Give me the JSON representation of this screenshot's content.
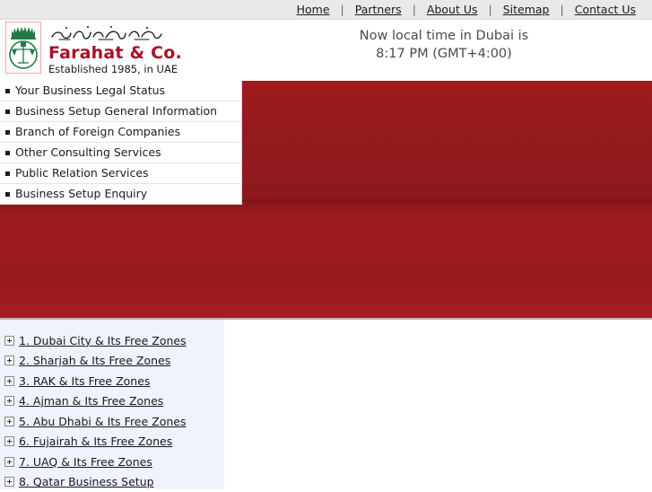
{
  "topnav": {
    "items": [
      {
        "label": "Home"
      },
      {
        "label": "Partners"
      },
      {
        "label": "About Us"
      },
      {
        "label": "Sitemap"
      },
      {
        "label": "Contact Us"
      }
    ],
    "separator": "|"
  },
  "header": {
    "brand_name": "Farahat & Co.",
    "brand_tagline": "Established 1985, in UAE",
    "emblem_icon": "scales-of-justice-palm-crown-icon",
    "arabic_script_icon": "arabic-calligraphy-logo",
    "clock_line1": "Now local time in Dubai is",
    "clock_line2": "8:17 PM (GMT+4:00)"
  },
  "menu": {
    "items": [
      {
        "label": "Your Business Legal Status"
      },
      {
        "label": "Business Setup General Information"
      },
      {
        "label": "Branch of Foreign Companies"
      },
      {
        "label": "Other Consulting Services"
      },
      {
        "label": "Public Relation Services"
      },
      {
        "label": "Business Setup Enquiry"
      }
    ]
  },
  "sidebar": {
    "items": [
      {
        "label": "1. Dubai City & Its Free Zones",
        "icon": "plus-expander-icon"
      },
      {
        "label": "2. Sharjah & Its Free Zones",
        "icon": "plus-expander-icon"
      },
      {
        "label": "3. RAK & Its Free Zones",
        "icon": "plus-expander-icon"
      },
      {
        "label": "4. Ajman & Its Free Zones",
        "icon": "plus-expander-icon"
      },
      {
        "label": "5. Abu Dhabi & Its Free Zones",
        "icon": "plus-expander-icon"
      },
      {
        "label": "6. Fujairah & Its Free Zones",
        "icon": "plus-expander-icon"
      },
      {
        "label": "7. UAQ & Its Free Zones",
        "icon": "plus-expander-icon"
      },
      {
        "label": "8. Qatar Business Setup",
        "icon": "plus-expander-icon"
      }
    ]
  },
  "colors": {
    "banner_red": "#9a1b1f",
    "brand_red": "#a8112a",
    "emblem_green": "#1f7a44",
    "sidebar_bg": "#f0f3fd",
    "topbar_bg": "#e9e9e9"
  }
}
